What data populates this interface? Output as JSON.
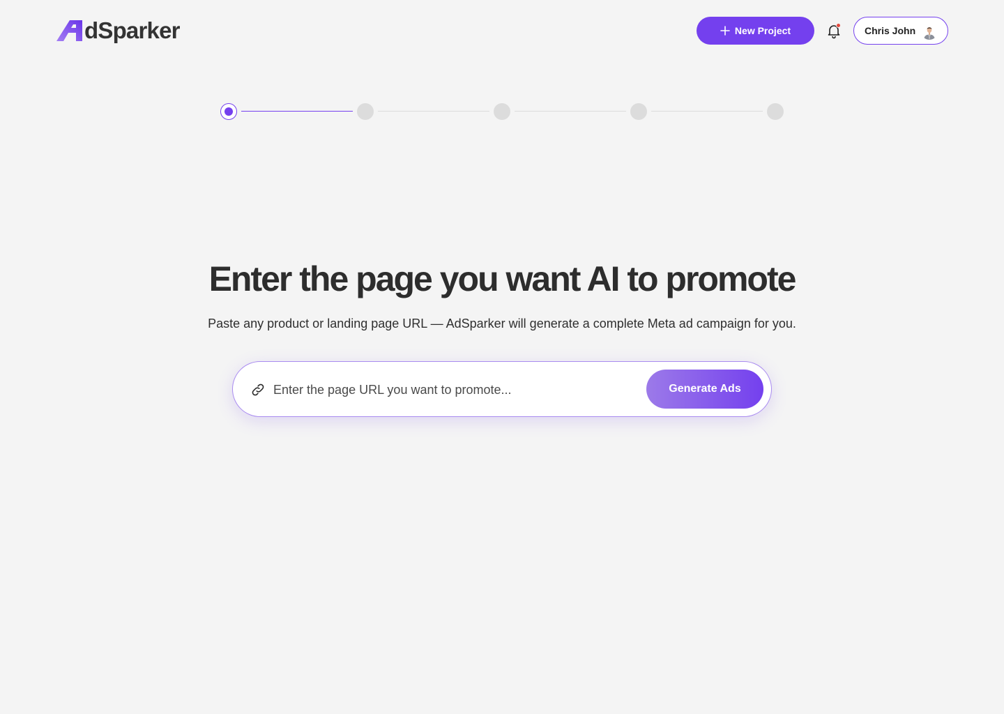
{
  "brand": {
    "name": "AdSparker",
    "logo_text": "dSparker",
    "accent_color": "#7440ee"
  },
  "header": {
    "new_project_label": "New Project",
    "new_project_icon": "plus-icon",
    "notification_icon": "bell-icon",
    "notification_badge_color": "#e4473b",
    "user": {
      "name": "Chris John",
      "avatar_icon": "user-avatar"
    }
  },
  "stepper": {
    "total_steps": 5,
    "current_step": 1
  },
  "hero": {
    "title": "Enter the page you want AI to promote",
    "subtitle": "Paste any product or landing page URL — AdSparker will generate a complete Meta ad campaign for you."
  },
  "url_form": {
    "icon": "link-icon",
    "placeholder": "Enter the page URL you want to promote...",
    "value": "",
    "submit_label": "Generate Ads"
  }
}
